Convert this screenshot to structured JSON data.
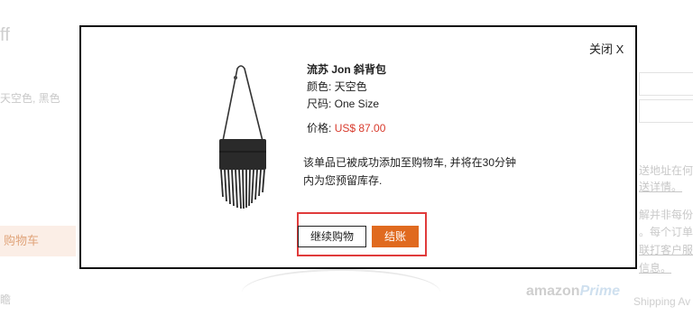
{
  "background": {
    "heading_fragment": "ff",
    "color_fragment": "天空色, 黑色",
    "cart_fragment": "购物车",
    "side_fragment": "瞻",
    "right_lines": [
      {
        "text": "送地址在何",
        "link": false
      },
      {
        "text": "送详情。",
        "link": true
      },
      {
        "text": "解并非每份",
        "link": false
      },
      {
        "text": "。每个订单",
        "link": false
      },
      {
        "text": "联打客户服务",
        "link": false
      },
      {
        "text": "信息。",
        "link": true
      }
    ],
    "amazon": "amazon",
    "prime": "Prime",
    "shipping": "Shipping Av"
  },
  "modal": {
    "close_label": "关闭 X",
    "product": {
      "name": "流苏 Jon 斜背包",
      "color_line": "颜色: 天空色",
      "size_line": "尺码: One Size",
      "price_label": "价格:",
      "price_value": "US$ 87.00"
    },
    "message_line1": "该单品已被成功添加至购物车, 并将在30分钟",
    "message_line2": "内为您预留库存.",
    "continue_label": "继续购物",
    "checkout_label": "结账"
  },
  "colors": {
    "accent": "#e06a1f",
    "price": "#d83a2c",
    "highlight": "#e03b3b"
  }
}
